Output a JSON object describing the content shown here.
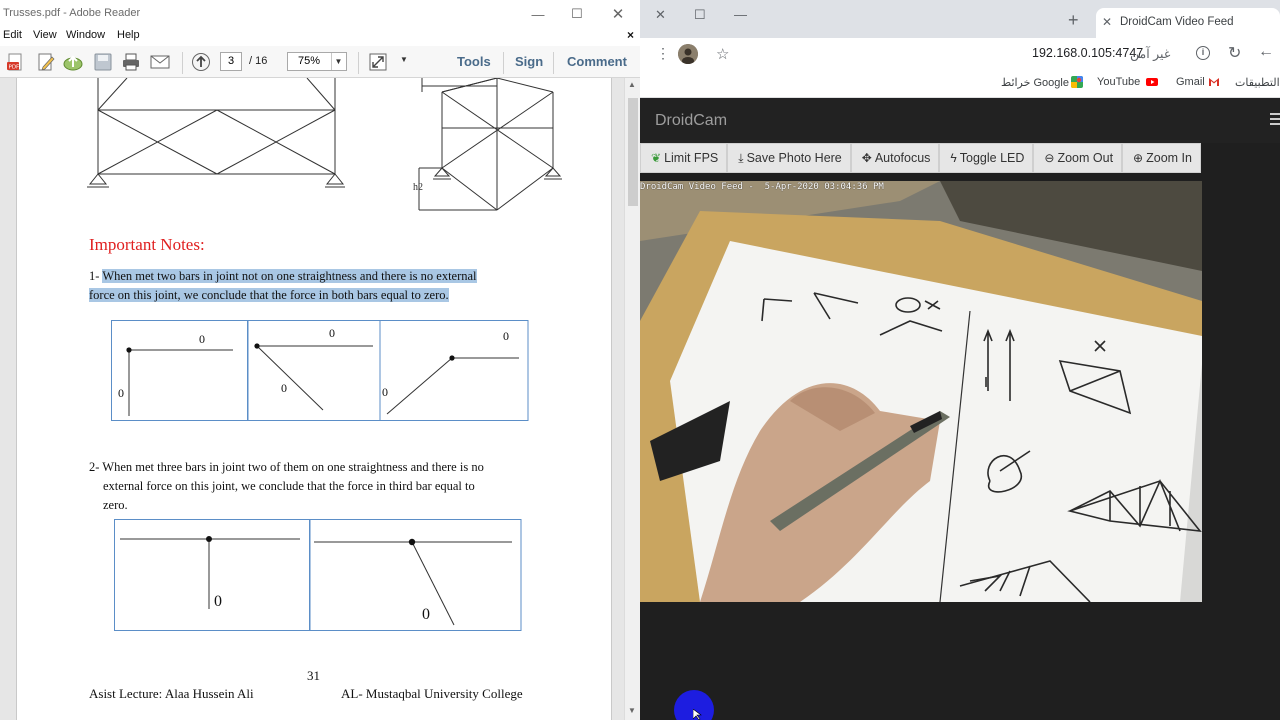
{
  "reader": {
    "title": "Trusses.pdf - Adobe Reader",
    "menu": [
      "Edit",
      "View",
      "Window",
      "Help"
    ],
    "menu_close": "×",
    "page_current": "3",
    "page_total": "/ 16",
    "zoom": "75%",
    "links": [
      "Tools",
      "Sign",
      "Comment"
    ],
    "document": {
      "h2_label": "h2",
      "notes_title": "Important Notes:",
      "note1_prefix": "1- ",
      "note1_line1": "When met two bars in joint not on one straightness and there is no external",
      "note1_line2": "force on this joint, we conclude that the force in both bars equal to zero.",
      "note2_line1": "2- When met three bars in joint two of them on one straightness and there is no",
      "note2_line2": "external force on this joint, we conclude that the force in third bar equal to",
      "note2_line3": "zero.",
      "zero_label": "0",
      "footer_page": "31",
      "footer_left": "Asist Lecture: Alaa Hussein Ali",
      "footer_right": "AL- Mustaqbal University College"
    }
  },
  "chrome": {
    "tab_title": "DroidCam Video Feed",
    "url": "192.168.0.105:4747",
    "not_secure": "غير آمن",
    "bookmarks": [
      "التطبيقات",
      "Gmail",
      "YouTube",
      "خرائط Google"
    ],
    "site": {
      "brand": "DroidCam",
      "buttons": [
        {
          "label": "Limit FPS",
          "icon": "leaf-icon"
        },
        {
          "label": "Save Photo Here",
          "icon": "download-icon"
        },
        {
          "label": "Autofocus",
          "icon": "move-icon"
        },
        {
          "label": "Toggle LED",
          "icon": "bolt-icon"
        },
        {
          "label": "Zoom Out",
          "icon": "zoom-out-icon"
        },
        {
          "label": "Zoom In",
          "icon": "zoom-in-icon"
        }
      ],
      "video_stamp": "DroidCam Video Feed -  5-Apr-2020 03:04:36 PM"
    }
  },
  "colors": {
    "notes_red": "#e02020",
    "highlight": "#a9c7e4",
    "diagram_box": "#5b8ec7",
    "cursor_blue": "#1d1de0"
  }
}
